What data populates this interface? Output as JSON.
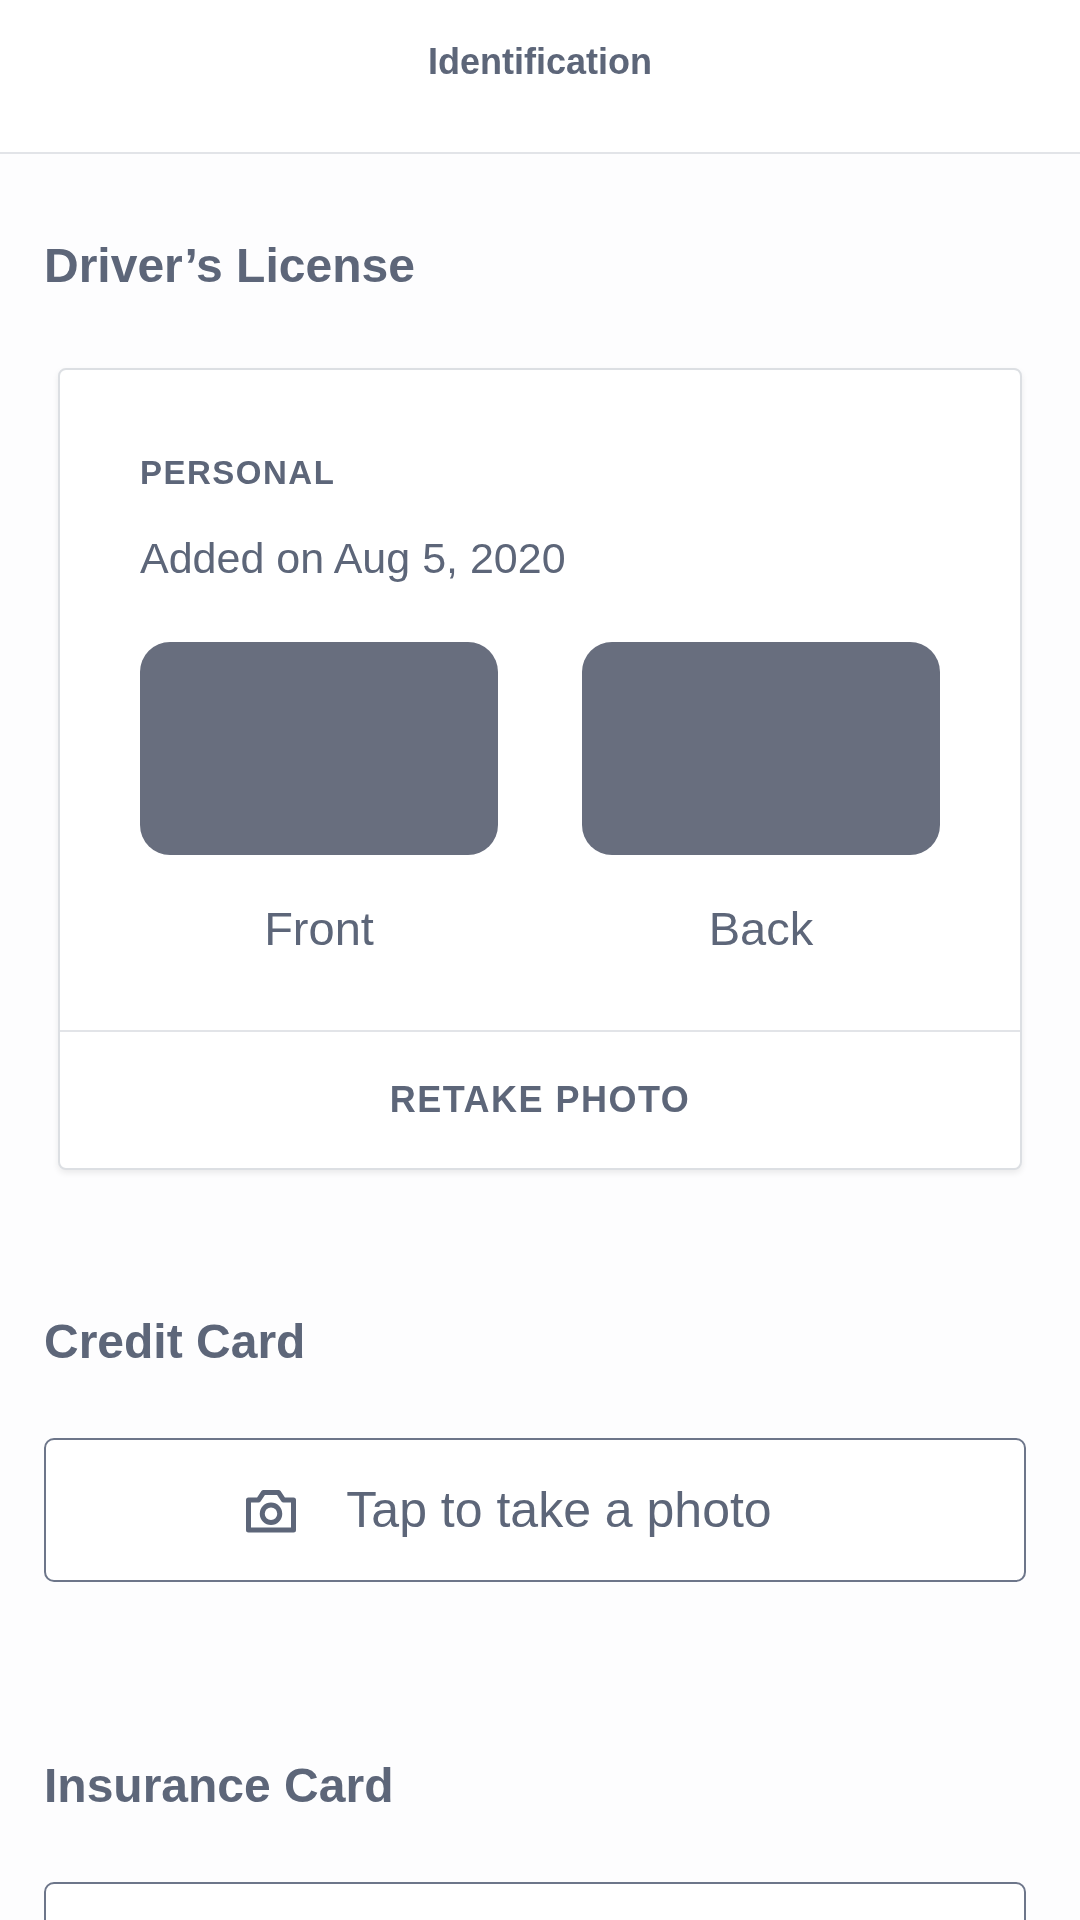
{
  "header": {
    "title": "Identification"
  },
  "sections": [
    {
      "kind": "document",
      "heading": "Driver’s License",
      "card": {
        "label": "PERSONAL",
        "added": "Added on Aug 5, 2020",
        "sides": [
          {
            "label": "Front"
          },
          {
            "label": "Back"
          }
        ],
        "action": "RETAKE PHOTO"
      }
    },
    {
      "kind": "capture",
      "heading": "Credit Card",
      "button": {
        "label": "Tap to take a photo"
      }
    },
    {
      "kind": "capture",
      "heading": "Insurance Card"
    }
  ]
}
